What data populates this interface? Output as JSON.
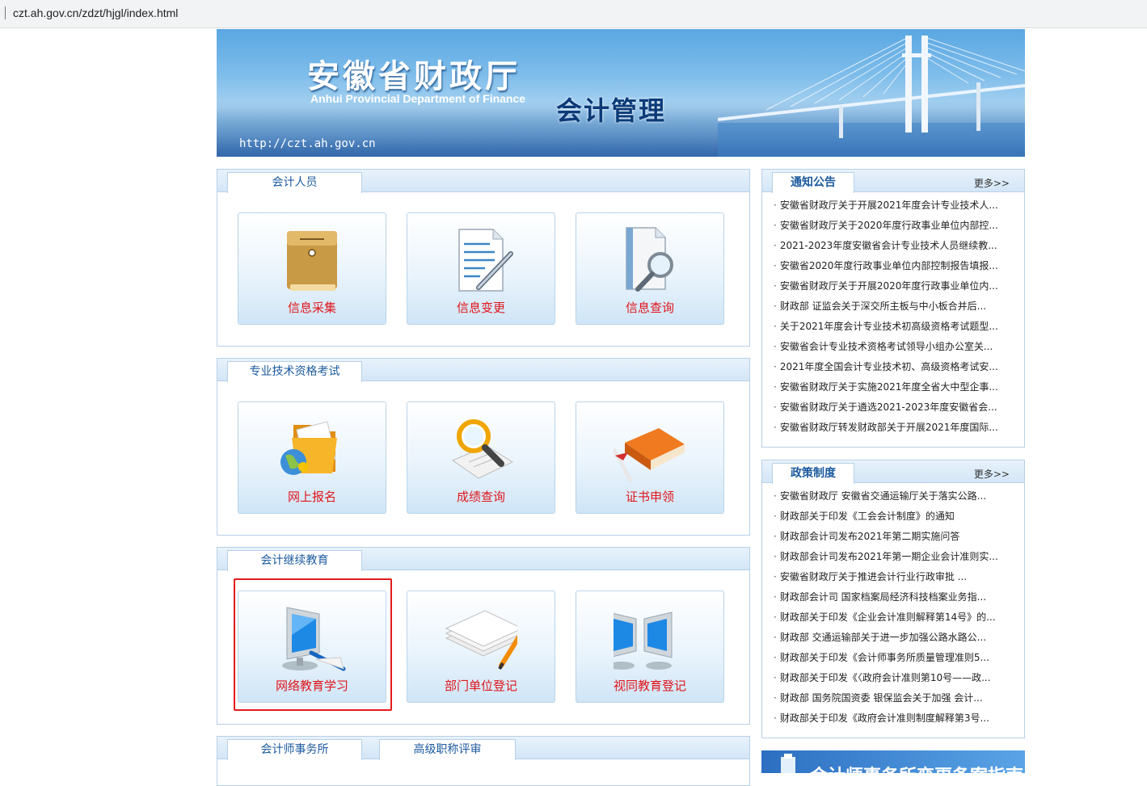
{
  "browser": {
    "url": "czt.ah.gov.cn/zdzt/hjgl/index.html"
  },
  "banner": {
    "title_cn": "安徽省财政厅",
    "title_en": "Anhui Provincial Department of Finance",
    "subtitle": "会计管理",
    "url": "http://czt.ah.gov.cn"
  },
  "sections": [
    {
      "tab": "会计人员",
      "tiles": [
        {
          "label": "信息采集",
          "icon": "archive-box-icon"
        },
        {
          "label": "信息变更",
          "icon": "document-pen-icon"
        },
        {
          "label": "信息查询",
          "icon": "document-magnifier-icon"
        }
      ]
    },
    {
      "tab": "专业技术资格考试",
      "tiles": [
        {
          "label": "网上报名",
          "icon": "folder-globe-icon"
        },
        {
          "label": "成绩查询",
          "icon": "magnifier-paper-icon"
        },
        {
          "label": "证书申领",
          "icon": "book-certificate-icon"
        }
      ]
    },
    {
      "tab": "会计继续教育",
      "tiles": [
        {
          "label": "网络教育学习",
          "icon": "computer-pen-icon"
        },
        {
          "label": "部门单位登记",
          "icon": "paper-stack-icon"
        },
        {
          "label": "视同教育登记",
          "icon": "two-computers-icon"
        }
      ]
    }
  ],
  "bottom_tabs": [
    "会计师事务所",
    "高级职称评审"
  ],
  "notices": {
    "title": "通知公告",
    "more": "更多>>",
    "items": [
      "安徽省财政厅关于开展2021年度会计专业技术人...",
      "安徽省财政厅关于2020年度行政事业单位内部控...",
      "2021-2023年度安徽省会计专业技术人员继续教...",
      "安徽省2020年度行政事业单位内部控制报告填报...",
      "安徽省财政厅关于开展2020年度行政事业单位内...",
      "财政部 证监会关于深交所主板与中小板合并后...",
      "关于2021年度会计专业技术初高级资格考试题型...",
      "安徽省会计专业技术资格考试领导小组办公室关...",
      "2021年度全国会计专业技术初、高级资格考试安...",
      "安徽省财政厅关于实施2021年度全省大中型企事...",
      "安徽省财政厅关于遴选2021-2023年度安徽省会...",
      "安徽省财政厅转发财政部关于开展2021年度国际..."
    ]
  },
  "policies": {
    "title": "政策制度",
    "more": "更多>>",
    "items": [
      "安徽省财政厅 安徽省交通运输厅关于落实公路...",
      "财政部关于印发《工会会计制度》的通知",
      "财政部会计司发布2021年第二期实施问答",
      "财政部会计司发布2021年第一期企业会计准则实...",
      "安徽省财政厅关于推进会计行业行政审批 ...",
      "财政部会计司 国家档案局经济科技档案业务指...",
      "财政部关于印发《企业会计准则解释第14号》的...",
      "财政部 交通运输部关于进一步加强公路水路公...",
      "财政部关于印发《会计师事务所质量管理准则5...",
      "财政部关于印发《〈政府会计准则第10号——政...",
      "财政部 国务院国资委 银保监会关于加强 会计...",
      "财政部关于印发《政府会计准则制度解释第3号..."
    ]
  },
  "guide_banner": {
    "text": "会计师事务所变更备案指南"
  }
}
